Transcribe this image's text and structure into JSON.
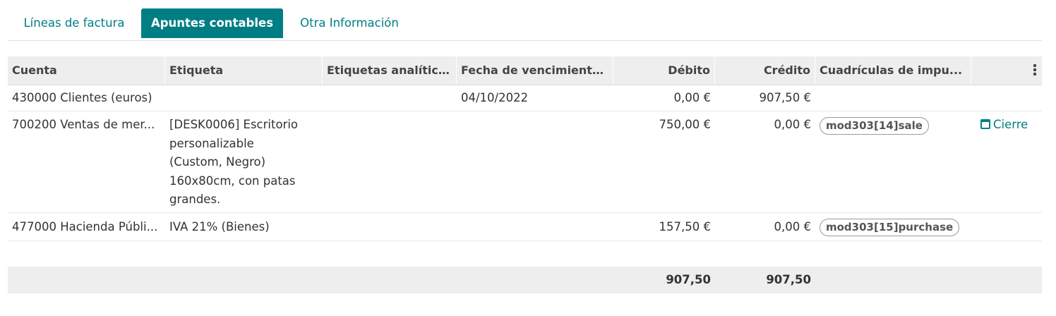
{
  "tabs": {
    "invoice_lines": "Líneas de factura",
    "journal_items": "Apuntes contables",
    "other_info": "Otra Información"
  },
  "columns": {
    "account": "Cuenta",
    "label": "Etiqueta",
    "analytic_tags": "Etiquetas analíticas",
    "due_date": "Fecha de vencimiento...",
    "debit": "Débito",
    "credit": "Crédito",
    "tax_grids": "Cuadrículas de impu..."
  },
  "rows": [
    {
      "account": "430000 Clientes (euros)",
      "label": "",
      "due_date": "04/10/2022",
      "debit": "0,00 €",
      "credit": "907,50 €",
      "tax_grid": "",
      "action": ""
    },
    {
      "account": "700200 Ventas de mer...",
      "label": "[DESK0006] Escritorio personalizable (Custom, Negro) 160x80cm, con patas grandes.",
      "due_date": "",
      "debit": "750,00 €",
      "credit": "0,00 €",
      "tax_grid": "mod303[14]sale",
      "action": "Cierre"
    },
    {
      "account": "477000 Hacienda Públi...",
      "label": "IVA 21% (Bienes)",
      "due_date": "",
      "debit": "157,50 €",
      "credit": "0,00 €",
      "tax_grid": "mod303[15]purchase",
      "action": ""
    }
  ],
  "totals": {
    "debit": "907,50",
    "credit": "907,50"
  },
  "colors": {
    "accent": "#017e84",
    "header_bg": "#eeeeee"
  },
  "icons": {
    "action_icon": "calendar-icon",
    "column_menu": "kebab-icon"
  }
}
